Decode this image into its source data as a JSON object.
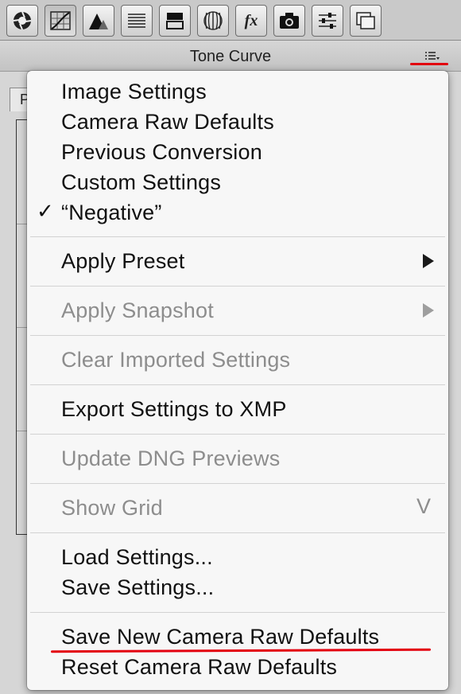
{
  "toolbar": {
    "icons": [
      "aperture-icon",
      "tone-curve-icon",
      "detail-triangle-icon",
      "hsl-lines-icon",
      "split-toning-icon",
      "lens-corrections-icon",
      "fx-icon",
      "camera-calibration-icon",
      "presets-sliders-icon",
      "snapshots-icon"
    ],
    "fx_label": "fx"
  },
  "panel": {
    "title": "Tone Curve",
    "background_tab_fragment": "P"
  },
  "menu": {
    "items": [
      {
        "label": "Image Settings",
        "enabled": true
      },
      {
        "label": "Camera Raw Defaults",
        "enabled": true
      },
      {
        "label": "Previous Conversion",
        "enabled": true
      },
      {
        "label": "Custom Settings",
        "enabled": true
      },
      {
        "label": "“Negative”",
        "enabled": true,
        "checked": true
      },
      {
        "label": "Apply Preset",
        "enabled": true,
        "submenu": true
      },
      {
        "label": "Apply Snapshot",
        "enabled": false,
        "submenu": true
      },
      {
        "label": "Clear Imported Settings",
        "enabled": false
      },
      {
        "label": "Export Settings to XMP",
        "enabled": true
      },
      {
        "label": "Update DNG Previews",
        "enabled": false
      },
      {
        "label": "Show Grid",
        "enabled": false,
        "shortcut": "V"
      },
      {
        "label": "Load Settings...",
        "enabled": true
      },
      {
        "label": "Save Settings...",
        "enabled": true
      },
      {
        "label": "Save New Camera Raw Defaults",
        "enabled": true,
        "highlighted_annotation": true
      },
      {
        "label": "Reset Camera Raw Defaults",
        "enabled": true
      }
    ],
    "checkmark": "✓"
  },
  "colors": {
    "annotation_red": "#e3000f",
    "disabled_text": "#8d8d8d",
    "menu_background": "#f7f7f7"
  }
}
